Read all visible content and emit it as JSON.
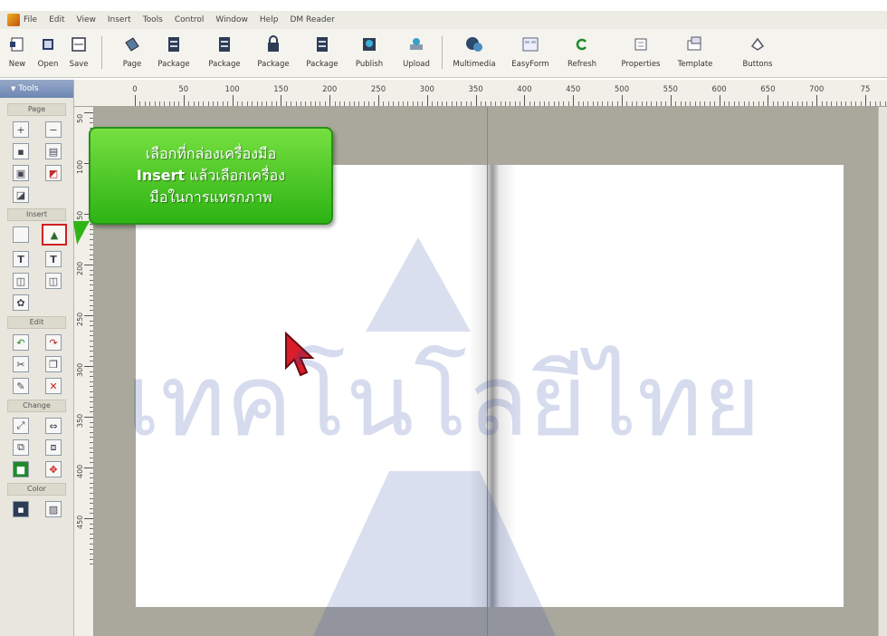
{
  "menu": [
    "File",
    "Edit",
    "View",
    "Insert",
    "Tools",
    "Control",
    "Window",
    "Help",
    "DM Reader"
  ],
  "toolbar": [
    {
      "label": "New",
      "icon": "new-page-icon"
    },
    {
      "label": "Open",
      "icon": "open-folder-icon"
    },
    {
      "label": "Save",
      "icon": "save-disk-icon"
    },
    {
      "label": "Page",
      "icon": "page-icon"
    },
    {
      "label": "Package",
      "icon": "package-icon"
    },
    {
      "label": "Package",
      "icon": "package-icon"
    },
    {
      "label": "Package",
      "icon": "package-lock-icon"
    },
    {
      "label": "Package",
      "icon": "package-icon"
    },
    {
      "label": "Publish",
      "icon": "publish-icon"
    },
    {
      "label": "Upload",
      "icon": "upload-icon"
    },
    {
      "label": "Multimedia",
      "icon": "multimedia-icon"
    },
    {
      "label": "EasyForm",
      "icon": "easyform-icon"
    },
    {
      "label": "Refresh",
      "icon": "refresh-icon"
    },
    {
      "label": "Properties",
      "icon": "properties-icon"
    },
    {
      "label": "Template",
      "icon": "template-icon"
    },
    {
      "label": "Buttons",
      "icon": "buttons-icon"
    }
  ],
  "tools": {
    "header": "Tools",
    "groups": [
      "Page",
      "Insert",
      "Edit",
      "Change",
      "Color"
    ]
  },
  "ruler": {
    "top": [
      "0",
      "50",
      "100",
      "150",
      "200",
      "250",
      "300",
      "350",
      "400",
      "450",
      "500",
      "550",
      "600",
      "650",
      "700",
      "75"
    ],
    "left": [
      "50",
      "100",
      "150",
      "200",
      "250",
      "300",
      "350",
      "400",
      "450"
    ]
  },
  "callout": {
    "line1": "เลือกที่กล่องเครื่องมือ",
    "line2_bold": "Insert",
    "line2_rest": " แล้วเลือกเครื่อง",
    "line3": "มือในการแทรกภาพ"
  },
  "watermark": {
    "text": "เทคโนโลยีไทย",
    "color": "#1a3aa0"
  },
  "colors": {
    "callout_green": "#3cc41e",
    "canvas_gray": "#aaa79c",
    "guide_green": "#4ea68a",
    "cursor_red": "#d81e2a"
  }
}
